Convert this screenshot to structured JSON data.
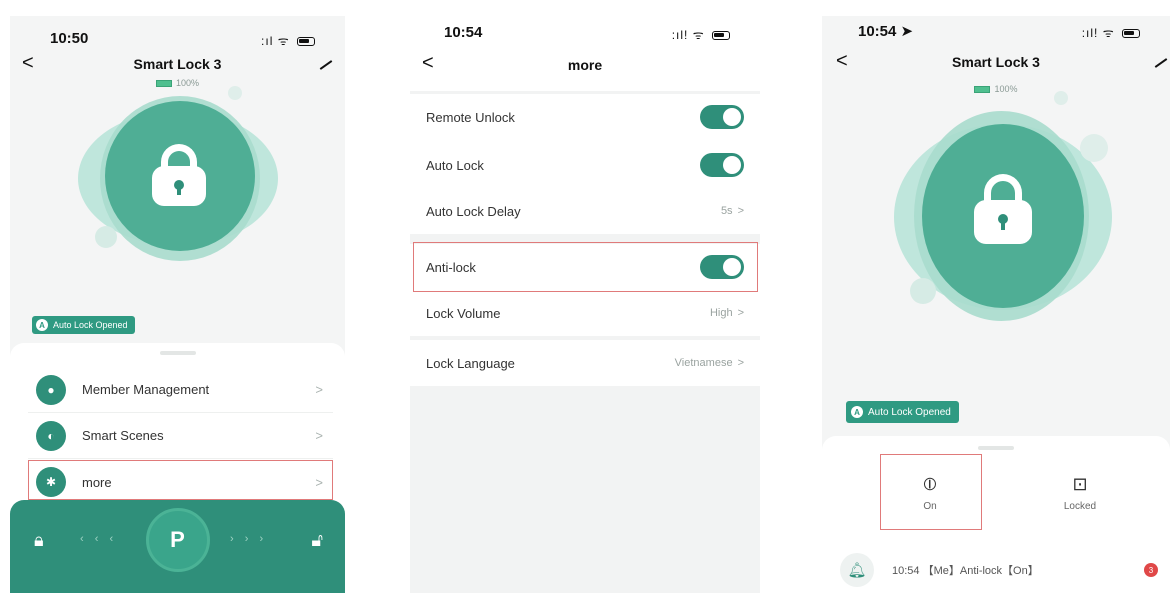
{
  "screen1": {
    "status": {
      "time": "10:50",
      "signal": ":ıl ᯤ"
    },
    "nav": {
      "back": "<",
      "title": "Smart Lock 3"
    },
    "battery": "100%",
    "badge": {
      "icon": "A",
      "label": "Auto Lock Opened"
    },
    "menu": [
      {
        "label": "Member Management",
        "icon": "user-icon",
        "glyph": "●"
      },
      {
        "label": "Smart Scenes",
        "icon": "toggle-icon",
        "glyph": "◐"
      },
      {
        "label": "more",
        "icon": "gear-icon",
        "glyph": "✱"
      }
    ],
    "chevron": ">",
    "bottom": {
      "left_arrows": "‹ ‹ ‹",
      "right_arrows": "› › ›",
      "center_glyph": "P"
    }
  },
  "screen2": {
    "status": {
      "time": "10:54",
      "signal": ":ıl! ᯤ"
    },
    "nav": {
      "back": "<",
      "title": "more"
    },
    "group1": [
      {
        "label": "Remote Unlock",
        "type": "toggle",
        "on": true
      },
      {
        "label": "Auto Lock",
        "type": "toggle",
        "on": true
      },
      {
        "label": "Auto Lock Delay",
        "type": "value",
        "value": "5s"
      }
    ],
    "group2": [
      {
        "label": "Anti-lock",
        "type": "toggle",
        "on": true
      },
      {
        "label": "Lock Volume",
        "type": "value",
        "value": "High"
      }
    ],
    "group3": [
      {
        "label": "Lock Language",
        "type": "value",
        "value": "Vietnamese"
      }
    ],
    "chevron": ">"
  },
  "screen3": {
    "status": {
      "time": "10:54 ➤",
      "signal": ":ıl! ᯤ"
    },
    "nav": {
      "back": "<",
      "title": "Smart Lock 3"
    },
    "battery": "100%",
    "badge": {
      "icon": "A",
      "label": "Auto Lock Opened"
    },
    "controls": [
      {
        "label": "On",
        "glyph": "⦶"
      },
      {
        "label": "Locked",
        "glyph": "⊡"
      }
    ],
    "log": {
      "text": "10:54 【Me】Anti-lock【On】",
      "count": "3"
    }
  },
  "colors": {
    "accent": "#2f8f7a",
    "highlight": "#e07a7a"
  }
}
